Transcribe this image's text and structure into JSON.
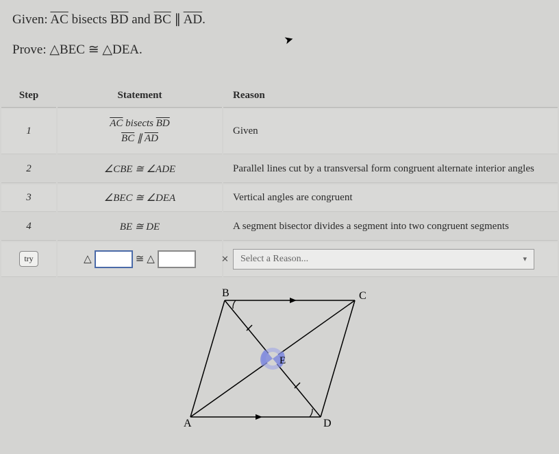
{
  "given": {
    "prefix": "Given: ",
    "seg1": "AC",
    "mid1": " bisects ",
    "seg2": "BD",
    "mid2": " and ",
    "seg3": "BC",
    "parallel": " ∥ ",
    "seg4": "AD",
    "end": "."
  },
  "prove": {
    "prefix": "Prove: ",
    "tri1": "△BEC",
    "cong": " ≅ ",
    "tri2": "△DEA",
    "end": "."
  },
  "headers": {
    "step": "Step",
    "statement": "Statement",
    "reason": "Reason"
  },
  "rows": [
    {
      "step": "1",
      "statement_line1_pre": "AC",
      "statement_line1_mid": " bisects ",
      "statement_line1_post": "BD",
      "statement_line2_pre": "BC",
      "statement_line2_mid": " ∥ ",
      "statement_line2_post": "AD",
      "reason": "Given"
    },
    {
      "step": "2",
      "statement": "∠CBE ≅ ∠ADE",
      "reason": "Parallel lines cut by a transversal form congruent alternate interior angles"
    },
    {
      "step": "3",
      "statement": "∠BEC ≅ ∠DEA",
      "reason": "Vertical angles are congruent"
    },
    {
      "step": "4",
      "statement": "BE ≅ DE",
      "reason": "A segment bisector divides a segment into two congruent segments"
    }
  ],
  "input_row": {
    "try_label": "try",
    "tri_symbol": "△",
    "cong_symbol": "≅",
    "reason_placeholder": "Select a Reason..."
  },
  "figure": {
    "B": "B",
    "C": "C",
    "A": "A",
    "D": "D",
    "E": "E"
  }
}
